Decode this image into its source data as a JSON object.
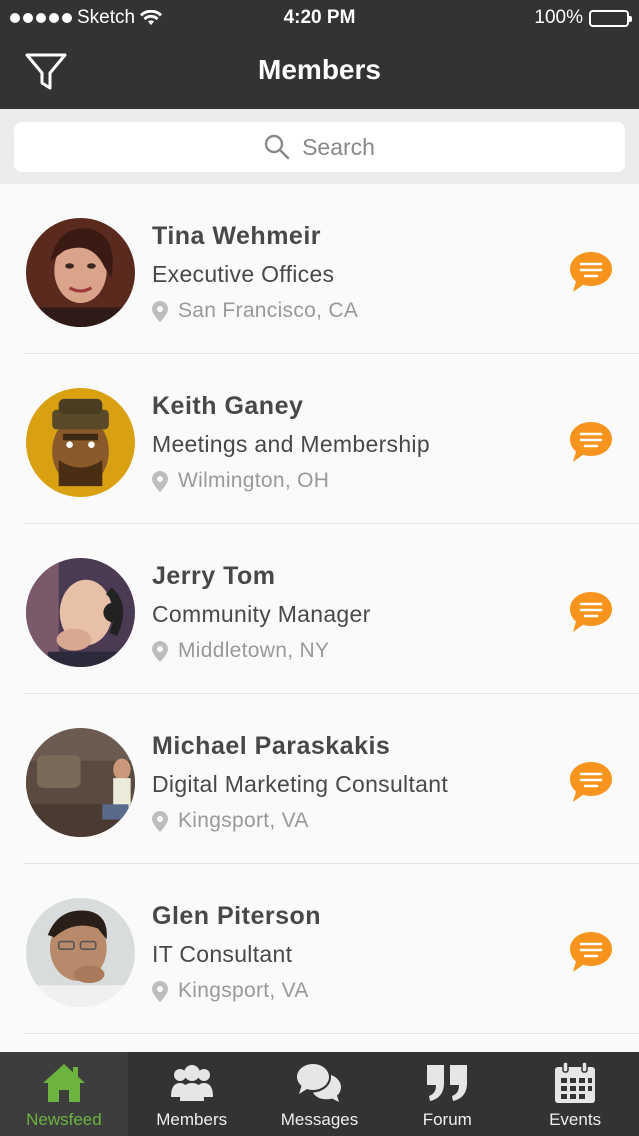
{
  "status": {
    "carrier": "Sketch",
    "time": "4:20 PM",
    "battery": "100%"
  },
  "header": {
    "title": "Members",
    "filter_icon": "filter-icon"
  },
  "search": {
    "placeholder": "Search"
  },
  "members": [
    {
      "name": "Tina Wehmeir",
      "role": "Executive Offices",
      "location": "San Francisco, CA"
    },
    {
      "name": "Keith Ganey",
      "role": "Meetings and Membership",
      "location": "Wilmington, OH"
    },
    {
      "name": "Jerry Tom",
      "role": "Community Manager",
      "location": "Middletown, NY"
    },
    {
      "name": "Michael Paraskakis",
      "role": "Digital Marketing Consultant",
      "location": "Kingsport, VA"
    },
    {
      "name": "Glen Piterson",
      "role": "IT Consultant",
      "location": "Kingsport, VA"
    }
  ],
  "tabs": [
    {
      "label": "Newsfeed",
      "icon": "home-icon",
      "active": true
    },
    {
      "label": "Members",
      "icon": "members-icon",
      "active": false
    },
    {
      "label": "Messages",
      "icon": "chat-bubbles-icon",
      "active": false
    },
    {
      "label": "Forum",
      "icon": "quote-icon",
      "active": false
    },
    {
      "label": "Events",
      "icon": "calendar-icon",
      "active": false
    }
  ],
  "colors": {
    "bar": "#333333",
    "accent_orange": "#f7941d",
    "active_green": "#6db33f"
  }
}
